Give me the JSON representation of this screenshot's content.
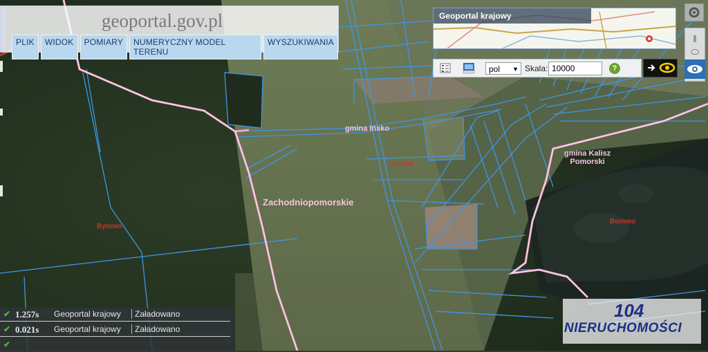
{
  "app": {
    "logo": "geoportal.gov.pl",
    "menu": [
      "PLIK",
      "WIDOK",
      "POMIARY",
      "NUMERYCZNY MODEL TERENU",
      "WYSZUKIWANIA"
    ]
  },
  "overview": {
    "title": "Geoportal krajowy"
  },
  "toolbar": {
    "language": "pol",
    "scale_label": "Skala:",
    "scale_value": "10000",
    "help_label": "?"
  },
  "map_labels": {
    "gmina_insko": "gmina Ińsko",
    "gmina_kalisz": "gmina Kalisz\nPomorski",
    "region": "Zachodniopomorskie",
    "place_left": "Bytowo",
    "place_center": "Czertyń",
    "place_right": "Borowo"
  },
  "status": [
    {
      "time": "1.257s",
      "source": "Geoportal krajowy",
      "state": "Załadowano"
    },
    {
      "time": "0.021s",
      "source": "Geoportal krajowy",
      "state": "Załadowano"
    },
    {
      "time": "",
      "source": "",
      "state": ""
    }
  ],
  "brand": {
    "number": "104",
    "name": "NIERUCHOMOŚCI"
  },
  "colors": {
    "parcel_line": "#3f96e6",
    "boundary": "#f0a6cf",
    "label_pink": "#f5c4e0",
    "label_red": "#c0392b",
    "brand_blue": "#1c2f8a"
  }
}
